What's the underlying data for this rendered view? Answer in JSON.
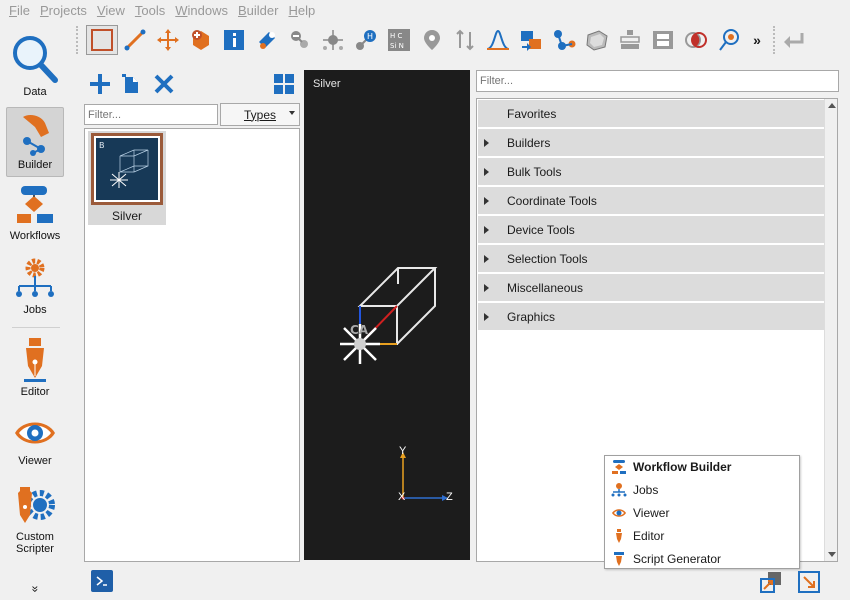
{
  "menubar": {
    "items": [
      {
        "label": "File",
        "mn": "F",
        "rest": "ile"
      },
      {
        "label": "Projects",
        "mn": "P",
        "rest": "rojects"
      },
      {
        "label": "View",
        "mn": "V",
        "rest": "iew"
      },
      {
        "label": "Tools",
        "mn": "T",
        "rest": "ools"
      },
      {
        "label": "Windows",
        "mn": "W",
        "rest": "indows"
      },
      {
        "label": "Builder",
        "mn": "B",
        "rest": "uilder"
      },
      {
        "label": "Help",
        "mn": "H",
        "rest": "elp"
      }
    ]
  },
  "rail": {
    "items": [
      {
        "label": "Data",
        "icon": "magnifier-icon"
      },
      {
        "label": "Builder",
        "icon": "builder-hand-icon"
      },
      {
        "label": "Workflows",
        "icon": "workflows-icon"
      },
      {
        "label": "Jobs",
        "icon": "jobs-gear-icon"
      },
      {
        "label": "Editor",
        "icon": "pen-nib-icon"
      },
      {
        "label": "Viewer",
        "icon": "eye-icon"
      },
      {
        "label": "Custom",
        "label2": "Scripter",
        "icon": "custom-scripter-icon"
      }
    ],
    "more": "»"
  },
  "toolbar": {
    "overflow": "»",
    "tools": [
      "select-box-icon",
      "ruler-icon",
      "move-arrows-icon",
      "add-atom-icon",
      "info-icon",
      "bond-tool-icon",
      "delete-atom-icon",
      "center-atom-icon",
      "hydrogen-icon",
      "hcsin-icon",
      "pin-icon",
      "rotate-arrows-icon",
      "gaussian-peak-icon",
      "transfer-icon",
      "molecule-graph-icon",
      "crystal-icon",
      "lattice-icon",
      "film-icon",
      "venn-icon",
      "pipette-icon"
    ]
  },
  "builder": {
    "filter_placeholder": "Filter...",
    "types_label": "Types",
    "structures": [
      {
        "name": "Silver",
        "badge": "B"
      }
    ]
  },
  "viewer": {
    "title": "Silver",
    "axis_y": "Y",
    "axis_x": "X",
    "axis_z": "Z"
  },
  "tools_panel": {
    "filter_placeholder": "Filter...",
    "categories": [
      {
        "label": "Favorites",
        "expandable": false
      },
      {
        "label": "Builders",
        "expandable": true
      },
      {
        "label": "Bulk Tools",
        "expandable": true
      },
      {
        "label": "Coordinate Tools",
        "expandable": true
      },
      {
        "label": "Device Tools",
        "expandable": true
      },
      {
        "label": "Selection Tools",
        "expandable": true
      },
      {
        "label": "Miscellaneous",
        "expandable": true
      },
      {
        "label": "Graphics",
        "expandable": true
      }
    ]
  },
  "popup_menu": {
    "items": [
      {
        "label": "Workflow Builder",
        "bold": true,
        "icon": "workflow-builder-icon"
      },
      {
        "label": "Jobs",
        "bold": false,
        "icon": "jobs-icon"
      },
      {
        "label": "Viewer",
        "bold": false,
        "icon": "eye-icon"
      },
      {
        "label": "Editor",
        "bold": false,
        "icon": "pen-nib-icon"
      },
      {
        "label": "Script Generator",
        "bold": false,
        "icon": "script-generator-icon"
      }
    ]
  },
  "colors": {
    "accent_blue": "#1f6fc0",
    "accent_orange": "#e07020",
    "viewer_bg": "#1c1c1c",
    "thumb_bg": "#173957"
  }
}
